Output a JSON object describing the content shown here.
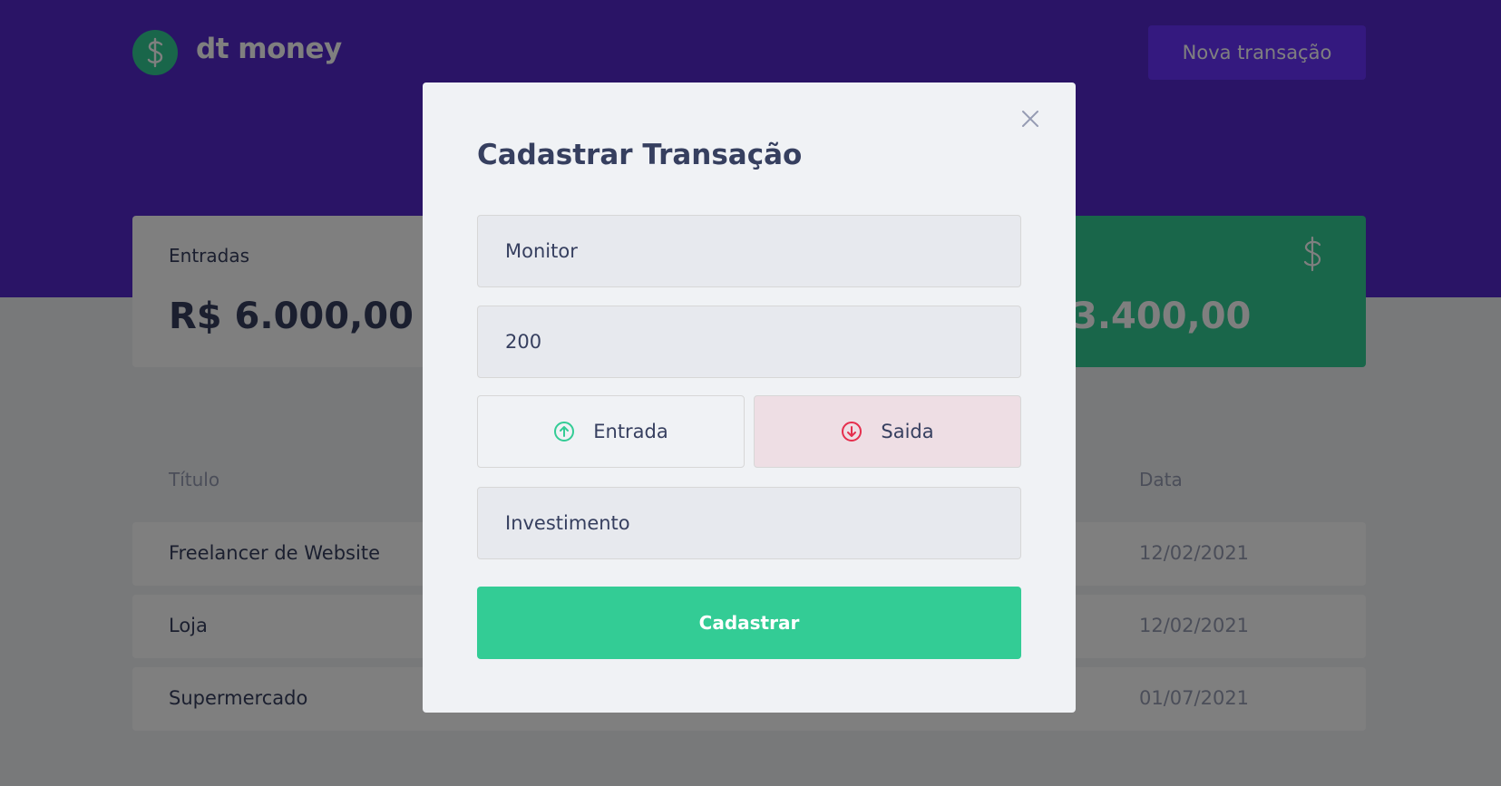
{
  "app": {
    "logo_text": "dt money",
    "new_button": "Nova transação"
  },
  "summary": {
    "income_label": "Entradas",
    "income_value": "R$ 6.000,00",
    "total_value_partial": "3.400,00"
  },
  "table": {
    "headers": {
      "title": "Título",
      "date": "Data"
    },
    "rows": [
      {
        "title": "Freelancer de Website",
        "date": "12/02/2021"
      },
      {
        "title": "Loja",
        "date": "12/02/2021"
      },
      {
        "title": "Supermercado",
        "date": "01/07/2021"
      }
    ]
  },
  "modal": {
    "title": "Cadastrar Transação",
    "title_value": "Monitor",
    "amount_value": "200",
    "type_income": "Entrada",
    "type_outcome": "Saida",
    "selected_type": "Saida",
    "category_value": "Investimento",
    "submit": "Cadastrar"
  },
  "colors": {
    "header": "#5429cc",
    "green": "#33cc95",
    "red": "#e52e4d",
    "text": "#363f5f",
    "muted": "#969cb3"
  },
  "icons": {
    "logo": "dollar-icon",
    "close": "close-icon",
    "income": "arrow-up-circle-icon",
    "outcome": "arrow-down-circle-icon"
  }
}
